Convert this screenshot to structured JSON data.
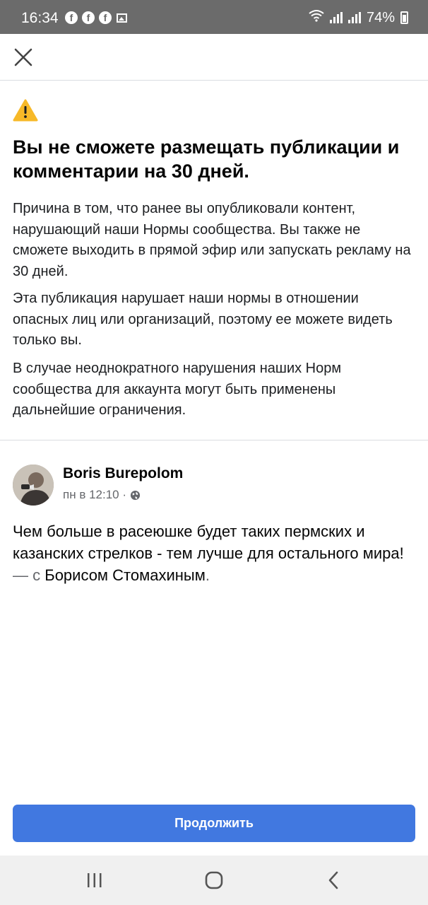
{
  "status_bar": {
    "time": "16:34",
    "battery": "74%",
    "notification_icons": [
      "facebook-icon",
      "facebook-icon",
      "facebook-icon",
      "gallery-icon"
    ]
  },
  "dialog": {
    "title": "Вы не сможете размещать публикации и комментарии на 30 дней.",
    "paragraphs": [
      "Причина в том, что ранее вы опубликовали контент, нарушающий наши Нормы сообщества. Вы также не сможете выходить в прямой эфир или запускать рекламу на 30 дней.",
      "Эта публикация нарушает наши нормы в отношении опасных лиц или организаций, поэтому ее можете видеть только вы.",
      "В случае неоднократного нарушения наших Норм сообщества для аккаунта могут быть применены дальнейшие ограничения."
    ],
    "warning_color": "#f7b928"
  },
  "post": {
    "author": "Boris Burepolom",
    "meta": "пн в 12:10 ·",
    "text": "Чем больше в расеюшке будет таких пермских и казанских стрелков - тем лучше для остального мира!",
    "tag_dash": "—",
    "tag_with": "с",
    "tagged": "Борисом Стомахиным",
    "tag_end": "."
  },
  "actions": {
    "continue_label": "Продолжить",
    "button_color": "#4178e0"
  }
}
